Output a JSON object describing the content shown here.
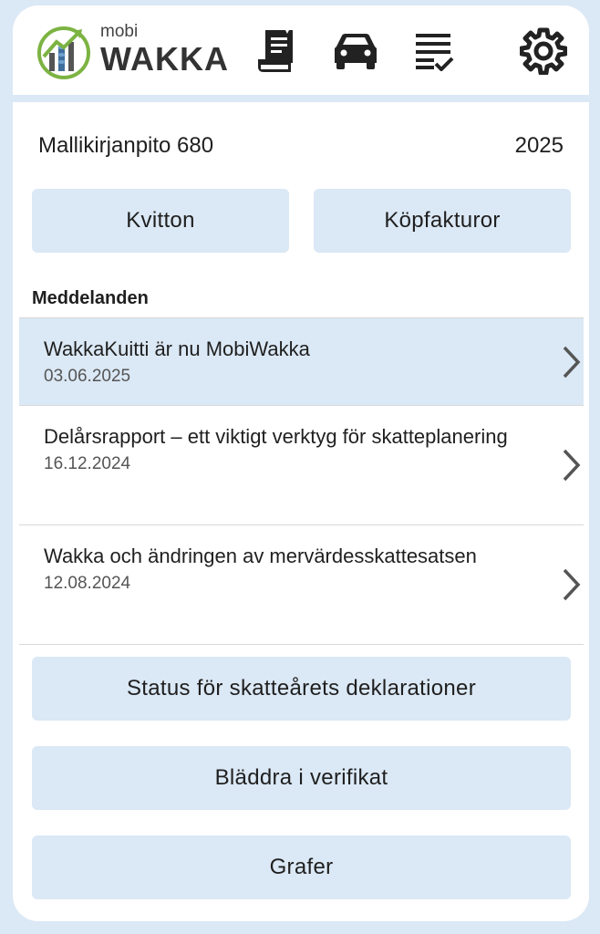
{
  "header": {
    "logo_small": "mobi",
    "logo_large": "WAKKA",
    "icons": [
      "receipt-icon",
      "car-icon",
      "checklist-icon",
      "gear-icon"
    ]
  },
  "company": {
    "name": "Mallikirjanpito 680",
    "year": "2025"
  },
  "buttons": {
    "receipts": "Kvitton",
    "purchase_invoices": "Köpfakturor"
  },
  "messages": {
    "title": "Meddelanden",
    "items": [
      {
        "title": "WakkaKuitti är nu MobiWakka",
        "date": "03.06.2025"
      },
      {
        "title": "Delårsrapport – ett viktigt verktyg för skatteplanering",
        "date": "16.12.2024"
      },
      {
        "title": "Wakka och ändringen av mervärdesskattesatsen",
        "date": "12.08.2024"
      }
    ]
  },
  "actions": {
    "tax_status": "Status för skatteårets deklarationer",
    "browse_vouchers": "Bläddra i verifikat",
    "graphs": "Grafer"
  },
  "colors": {
    "accent_bg": "#dbe8f5",
    "logo_green": "#7cb342",
    "logo_blue": "#3f6e9c"
  }
}
